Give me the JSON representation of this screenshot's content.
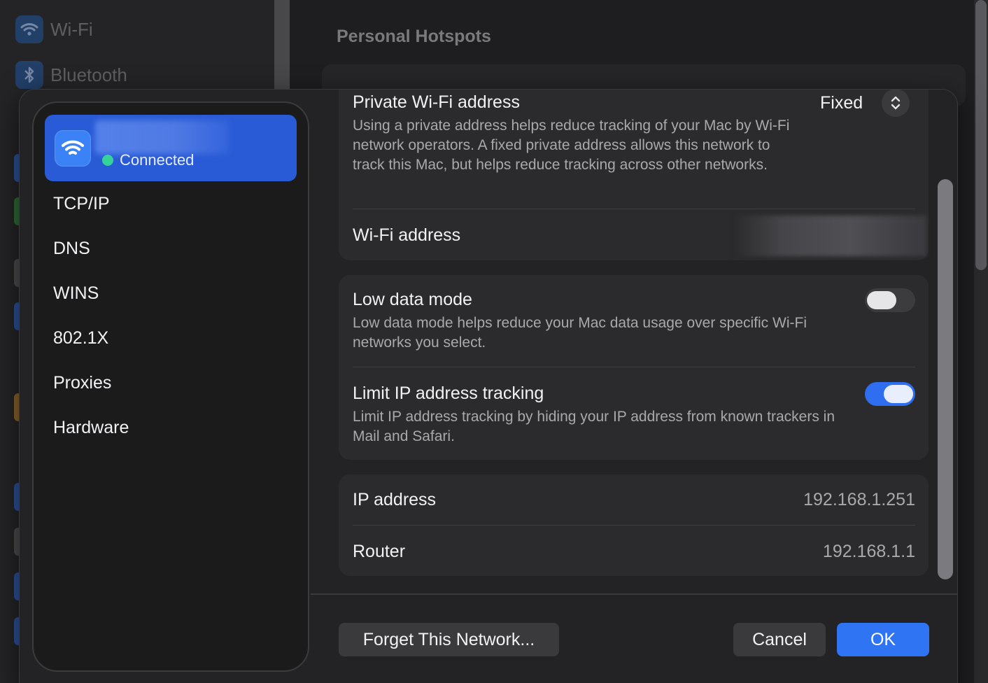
{
  "background": {
    "sidebar_items": [
      {
        "label": "Wi-Fi",
        "icon": "wifi-icon"
      },
      {
        "label": "Bluetooth",
        "icon": "bluetooth-icon"
      }
    ],
    "section_heading": "Personal Hotspots"
  },
  "network": {
    "status": "Connected",
    "status_color": "#34d399",
    "icon": "wifi-icon"
  },
  "nav": {
    "items": [
      "TCP/IP",
      "DNS",
      "WINS",
      "802.1X",
      "Proxies",
      "Hardware"
    ]
  },
  "private_address": {
    "title": "Private Wi-Fi address",
    "value": "Fixed",
    "description": "Using a private address helps reduce tracking of your Mac by Wi-Fi network operators. A fixed private address allows this network to track this Mac, but helps reduce tracking across other networks."
  },
  "wifi_address": {
    "label": "Wi-Fi address"
  },
  "low_data_mode": {
    "title": "Low data mode",
    "description": "Low data mode helps reduce your Mac data usage over specific Wi-Fi networks you select.",
    "enabled": false
  },
  "limit_ip": {
    "title": "Limit IP address tracking",
    "description": "Limit IP address tracking by hiding your IP address from known trackers in Mail and Safari.",
    "enabled": true
  },
  "ip_address": {
    "label": "IP address",
    "value": "192.168.1.251"
  },
  "router": {
    "label": "Router",
    "value": "192.168.1.1"
  },
  "buttons": {
    "forget": "Forget This Network...",
    "cancel": "Cancel",
    "ok": "OK"
  },
  "colors": {
    "accent": "#2f74f3",
    "selected_tile": "#2a5bd6"
  }
}
